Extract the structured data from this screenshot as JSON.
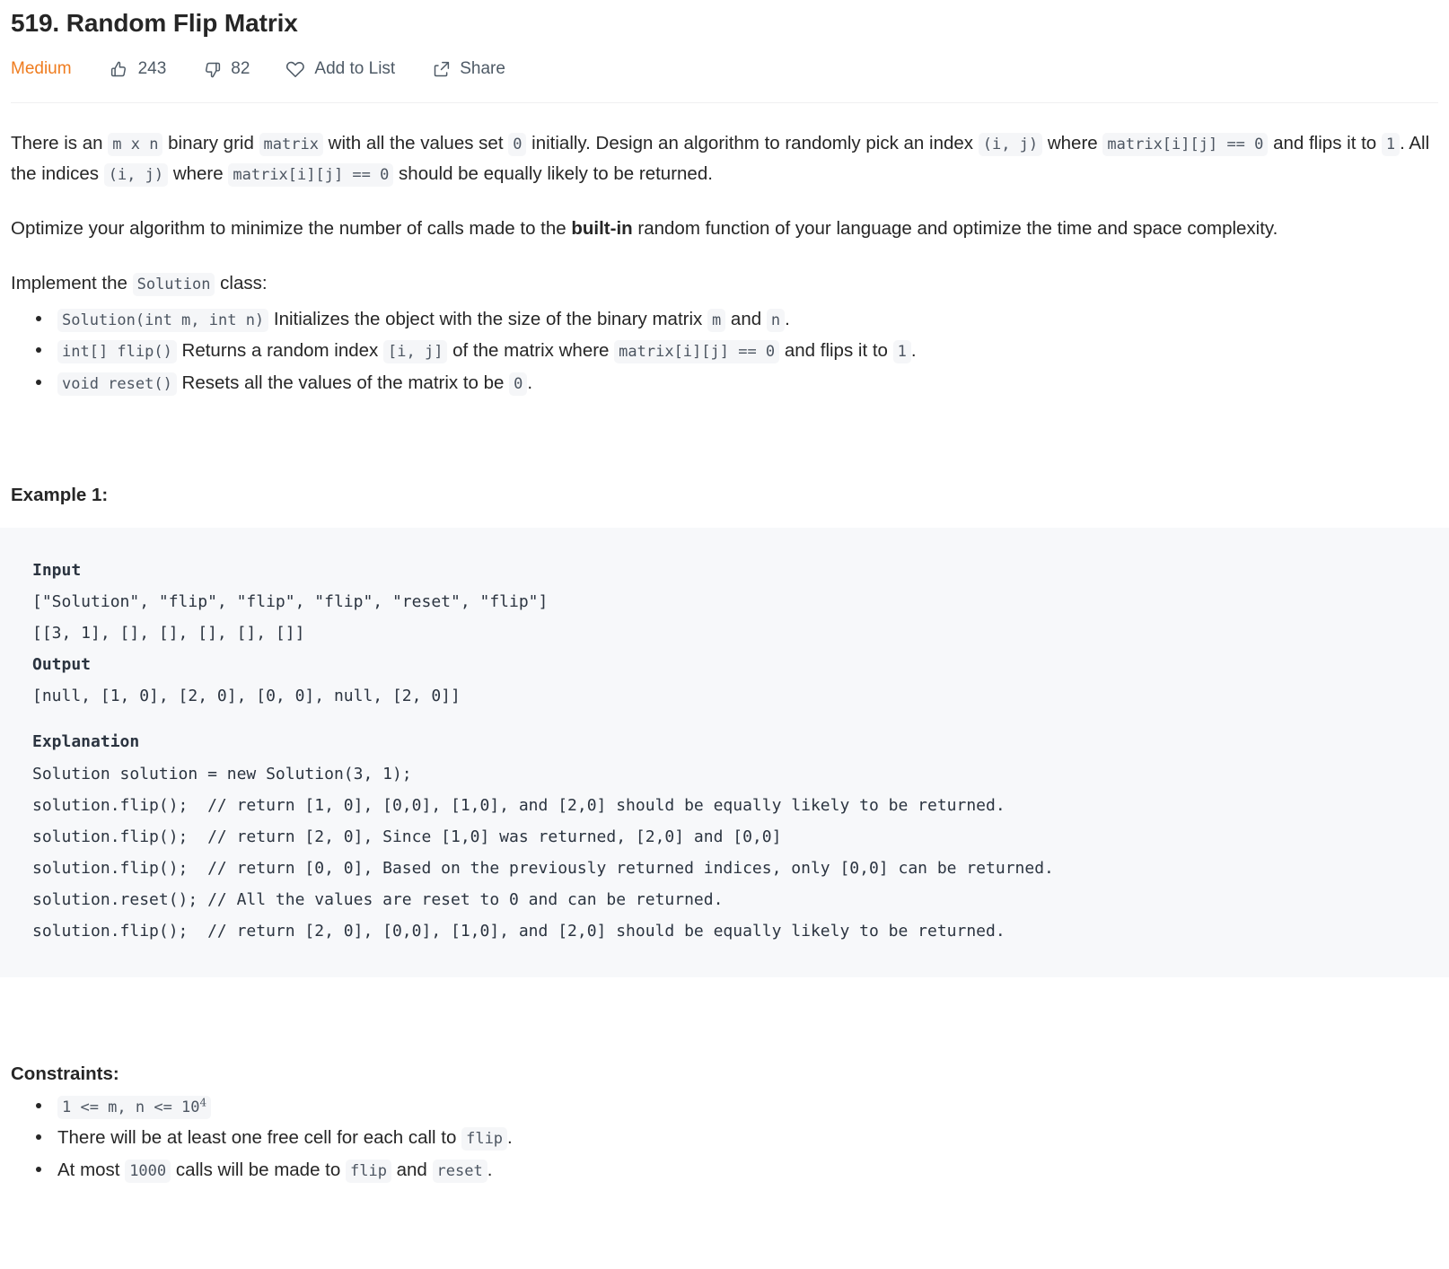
{
  "problem": {
    "title": "519. Random Flip Matrix",
    "difficulty": "Medium",
    "difficulty_color": "#ef7c1f",
    "likes": "243",
    "dislikes": "82",
    "add_to_list_label": "Add to List",
    "share_label": "Share"
  },
  "description": {
    "p1": {
      "t1": "There is an ",
      "c1": "m x n",
      "t2": " binary grid ",
      "c2": "matrix",
      "t3": " with all the values set ",
      "c3": "0",
      "t4": " initially. Design an algorithm to randomly pick an index ",
      "c4": "(i, j)",
      "t5": " where ",
      "c5": "matrix[i][j] == 0",
      "t6": " and flips it to ",
      "c6": "1",
      "t7": ". All the indices ",
      "c7": "(i, j)",
      "t8": " where ",
      "c8": "matrix[i][j] == 0",
      "t9": " should be equally likely to be returned."
    },
    "p2": {
      "t1": "Optimize your algorithm to minimize the number of calls made to the ",
      "bold": "built-in",
      "t2": " random function of your language and optimize the time and space complexity."
    },
    "p3": {
      "t1": "Implement the ",
      "c1": "Solution",
      "t2": " class:"
    },
    "methods": [
      {
        "code": "Solution(int m, int n)",
        "t1": " Initializes the object with the size of the binary matrix ",
        "c1": "m",
        "t2": " and ",
        "c2": "n",
        "t3": "."
      },
      {
        "code": "int[] flip()",
        "t1": " Returns a random index ",
        "c1": "[i, j]",
        "t2": " of the matrix where ",
        "c2": "matrix[i][j] == 0",
        "t3": " and flips it to ",
        "c3": "1",
        "t4": "."
      },
      {
        "code": "void reset()",
        "t1": " Resets all the values of the matrix to be ",
        "c1": "0",
        "t2": "."
      }
    ]
  },
  "example": {
    "heading": "Example 1:",
    "input_label": "Input",
    "input_lines": [
      "[\"Solution\", \"flip\", \"flip\", \"flip\", \"reset\", \"flip\"]",
      "[[3, 1], [], [], [], [], []]"
    ],
    "output_label": "Output",
    "output_lines": [
      "[null, [1, 0], [2, 0], [0, 0], null, [2, 0]]"
    ],
    "explanation_label": "Explanation",
    "explanation_lines": [
      "Solution solution = new Solution(3, 1);",
      "solution.flip();  // return [1, 0], [0,0], [1,0], and [2,0] should be equally likely to be returned.",
      "solution.flip();  // return [2, 0], Since [1,0] was returned, [2,0] and [0,0]",
      "solution.flip();  // return [0, 0], Based on the previously returned indices, only [0,0] can be returned.",
      "solution.reset(); // All the values are reset to 0 and can be returned.",
      "solution.flip();  // return [2, 0], [0,0], [1,0], and [2,0] should be equally likely to be returned."
    ]
  },
  "constraints": {
    "heading": "Constraints:",
    "items": [
      {
        "kind": "code_exp",
        "code_before": "1 <= m, n <= 10",
        "exponent": "4"
      },
      {
        "kind": "mixed",
        "t1": "There will be at least one free cell for each call to ",
        "c1": "flip",
        "t2": "."
      },
      {
        "kind": "mixed2",
        "t1": "At most ",
        "c1": "1000",
        "t2": " calls will be made to ",
        "c2": "flip",
        "t3": " and ",
        "c3": "reset",
        "t4": "."
      }
    ]
  }
}
